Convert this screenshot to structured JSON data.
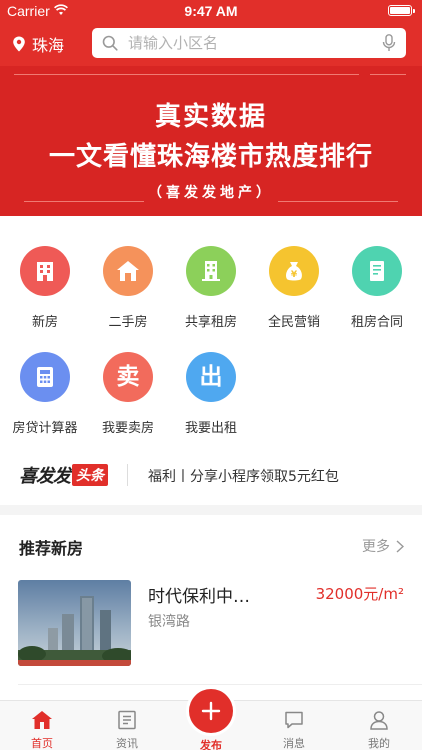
{
  "status_bar": {
    "carrier": "Carrier",
    "time": "9:47 AM"
  },
  "header": {
    "city": "珠海",
    "search_placeholder": "请输入小区名"
  },
  "banner": {
    "title_line1": "真实数据",
    "title_line2": "一文看懂珠海楼市热度排行",
    "subtitle": "（喜发发地产）"
  },
  "colors": {
    "accent": "#e12f2a"
  },
  "services": [
    {
      "label": "新房",
      "icon": "building-icon",
      "color": "#ef5a56"
    },
    {
      "label": "二手房",
      "icon": "house-icon",
      "color": "#f5925b"
    },
    {
      "label": "共享租房",
      "icon": "apartment-icon",
      "color": "#8cd05a"
    },
    {
      "label": "全民营销",
      "icon": "money-bag-icon",
      "color": "#f5c42f"
    },
    {
      "label": "租房合同",
      "icon": "document-icon",
      "color": "#4fd3b0"
    },
    {
      "label": "房贷计算器",
      "icon": "calculator-icon",
      "color": "#6b8ff0"
    },
    {
      "label": "我要卖房",
      "icon": "sell-icon",
      "glyph": "卖",
      "color": "#f26b5c"
    },
    {
      "label": "我要出租",
      "icon": "rent-out-icon",
      "glyph": "出",
      "color": "#4fa8f0"
    }
  ],
  "news": {
    "brand": "喜发发",
    "brand_tag": "头条",
    "text": "福利丨分享小程序领取5元红包"
  },
  "recommend": {
    "title": "推荐新房",
    "more": "更多",
    "items": [
      {
        "name": "时代保利中…",
        "address": "银湾路",
        "price": "32000元/m²"
      }
    ]
  },
  "tabbar": {
    "home": "首页",
    "news": "资讯",
    "publish": "发布",
    "messages": "消息",
    "mine": "我的"
  }
}
